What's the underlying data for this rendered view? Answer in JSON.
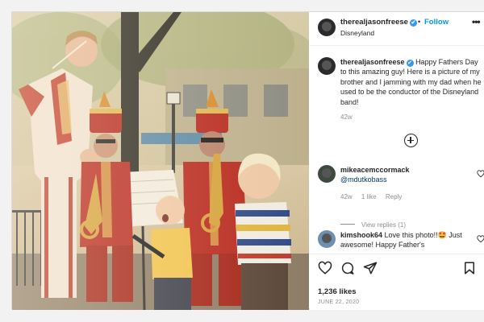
{
  "post": {
    "username": "therealjasonfreese",
    "verified_mark": "✔",
    "separator": "•",
    "follow_label": "Follow",
    "location": "Disneyland",
    "more_label": "•••",
    "caption": "Happy Fathers Day to this amazing guy! Here is a picture of my brother and I jamming with my dad when he used to be the conductor of the Disneyland band!",
    "caption_time": "42w"
  },
  "comments": [
    {
      "username": "mikeacemccormack",
      "mention": "@mdutkobass",
      "time": "42w",
      "likes": "1 like",
      "reply_label": "Reply",
      "view_replies": "View replies (1)"
    },
    {
      "username": "kimshook64",
      "text": "Love this photo!!🤩 Just awesome! Happy Father's"
    }
  ],
  "footer": {
    "likes": "1,236 likes",
    "date": "JUNE 22, 2020"
  },
  "icons": {
    "header": [
      "verified-badge-icon",
      "more-options-icon"
    ],
    "actions": [
      "heart-icon",
      "comment-icon",
      "share-icon",
      "bookmark-icon"
    ],
    "load_more": "plus-circle-icon"
  },
  "colors": {
    "link_blue": "#0095f6",
    "verified_blue": "#3897f0",
    "muted_gray": "#8e8e8e",
    "band_uniform_red": "#b8281e"
  }
}
